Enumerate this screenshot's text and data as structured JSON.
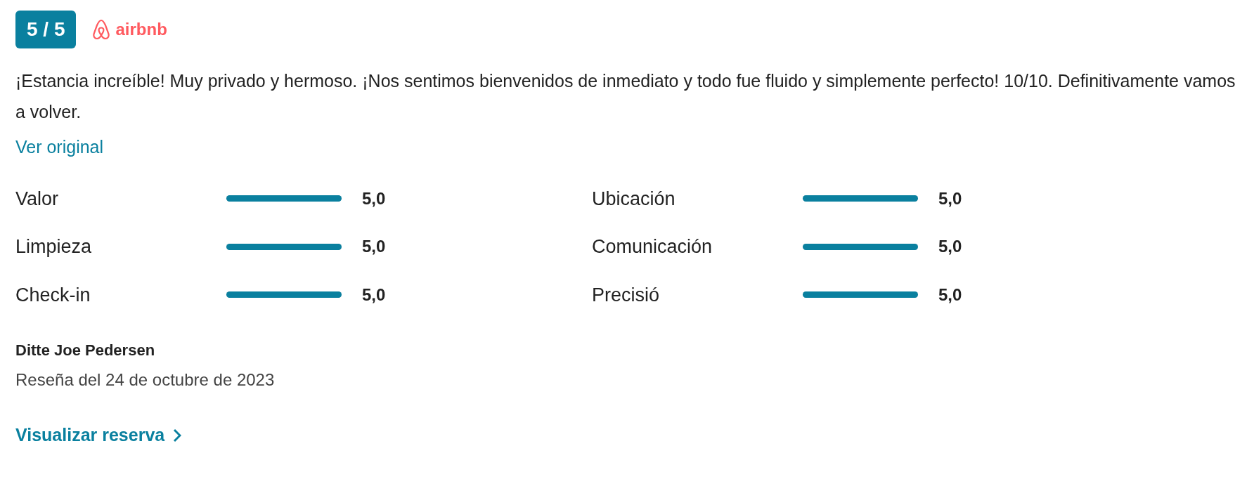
{
  "score_badge": "5 / 5",
  "source": {
    "name": "airbnb"
  },
  "review_text": "¡Estancia increíble! Muy privado y hermoso. ¡Nos sentimos bienvenidos de inmediato y todo fue fluido y simplemente perfecto! 10/10. Definitivamente vamos a volver.",
  "original_link": "Ver original",
  "ratings": [
    {
      "label": "Valor",
      "level": 1.0,
      "reading": "5,0"
    },
    {
      "label": "Ubicación",
      "level": 1.0,
      "reading": "5,0"
    },
    {
      "label": "Limpieza",
      "level": 1.0,
      "reading": "5,0"
    },
    {
      "label": "Comunicación",
      "level": 1.0,
      "reading": "5,0"
    },
    {
      "label": "Check-in",
      "level": 1.0,
      "reading": "5,0"
    },
    {
      "label": "Precisió",
      "level": 1.0,
      "reading": "5,0"
    }
  ],
  "reviewer": "Ditte Joe Pedersen",
  "review_date": "Reseña del 24 de octubre de 2023",
  "booking_link": "Visualizar reserva"
}
